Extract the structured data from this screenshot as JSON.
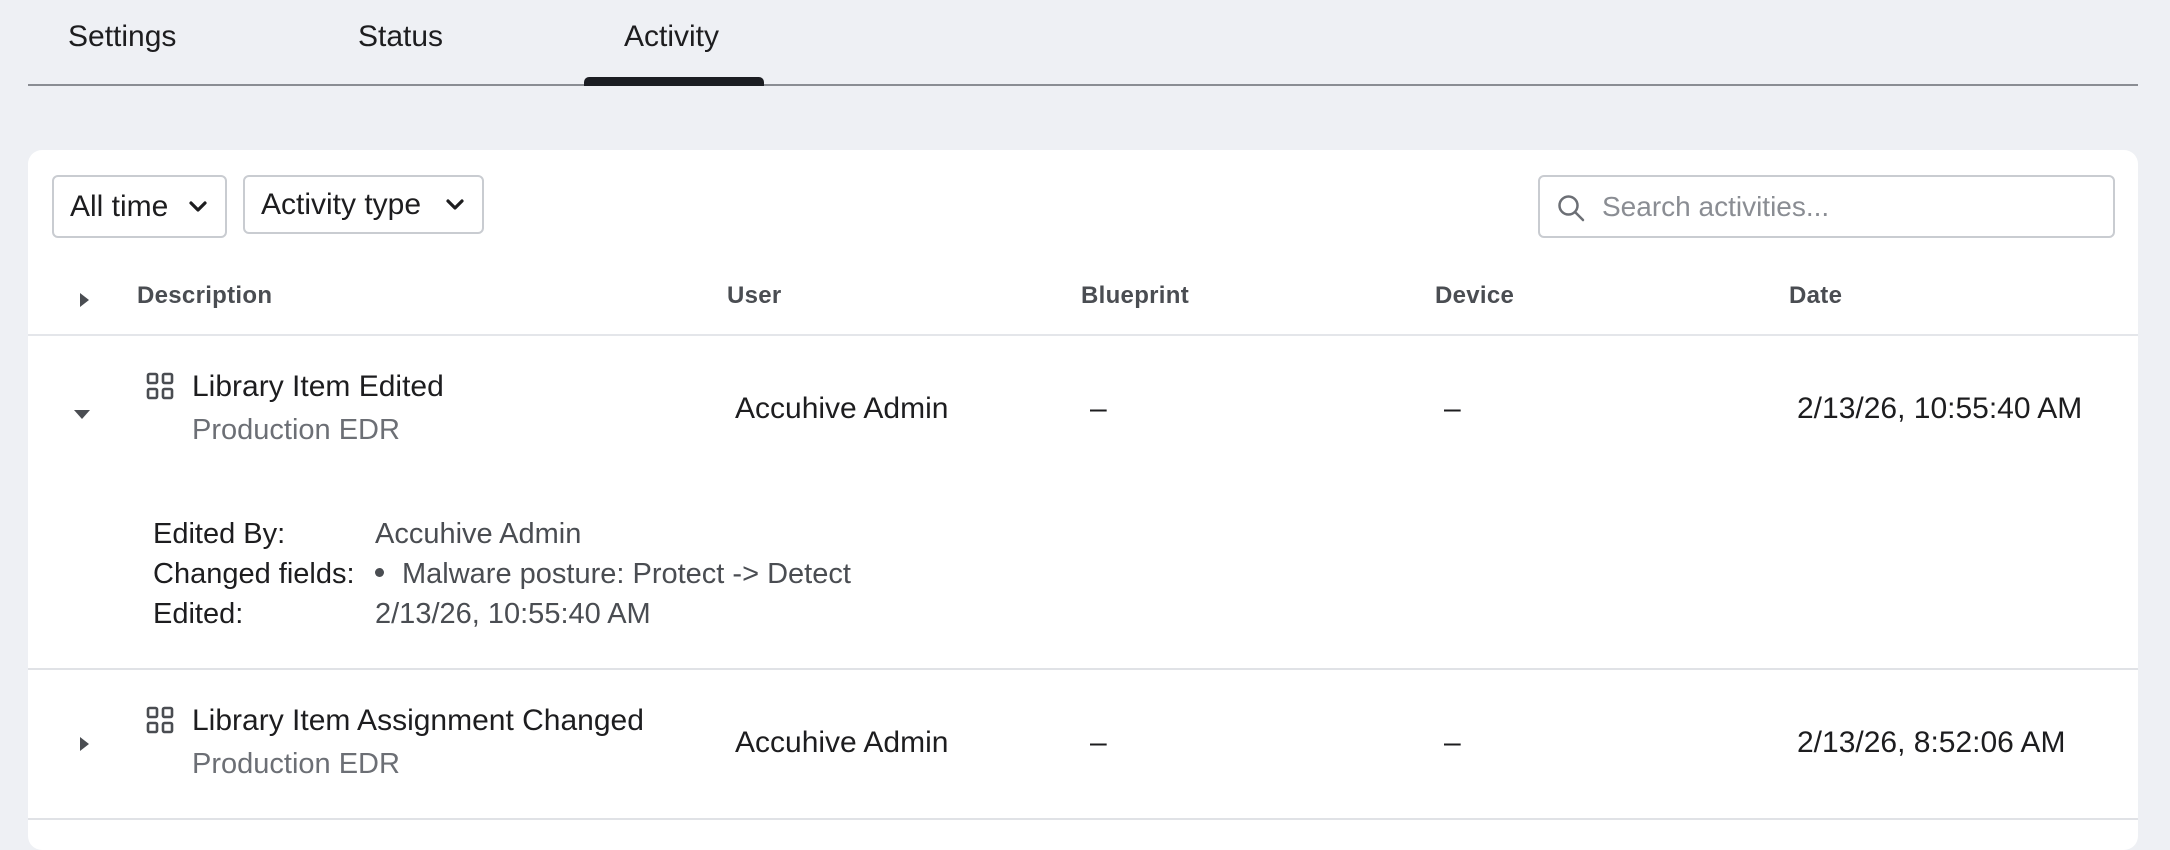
{
  "tabs": [
    {
      "label": "Settings",
      "active": false
    },
    {
      "label": "Status",
      "active": false
    },
    {
      "label": "Activity",
      "active": true
    }
  ],
  "filters": {
    "time": "All time",
    "activity_type": "Activity type"
  },
  "search": {
    "placeholder": "Search activities...",
    "value": ""
  },
  "table": {
    "columns": [
      "Description",
      "User",
      "Blueprint",
      "Device",
      "Date"
    ],
    "rows": [
      {
        "title": "Library Item Edited",
        "subtitle": "Production EDR",
        "user": "Accuhive Admin",
        "blueprint": "–",
        "device": "–",
        "date": "2/13/26, 10:55:40 AM",
        "expanded": true,
        "details": {
          "edited_by_label": "Edited By:",
          "edited_by_value": "Accuhive Admin",
          "changed_fields_label": "Changed fields:",
          "changed_fields": [
            "Malware posture: Protect -> Detect"
          ],
          "edited_label": "Edited:",
          "edited_value": "2/13/26, 10:55:40 AM"
        }
      },
      {
        "title": "Library Item Assignment Changed",
        "subtitle": "Production EDR",
        "user": "Accuhive Admin",
        "blueprint": "–",
        "device": "–",
        "date": "2/13/26, 8:52:06 AM",
        "expanded": false
      }
    ]
  },
  "colors": {
    "page_bg": "#eef0f4",
    "card_bg": "#ffffff",
    "tab_active_indicator": "#1b1d22",
    "muted_text": "#6c6f75"
  },
  "icons": {
    "expand_all": "caret-right-icon",
    "row_expanded": "caret-down-icon",
    "row_collapsed": "caret-right-icon",
    "library_item": "grid-icon",
    "dropdown": "chevron-down-icon",
    "search": "search-icon"
  }
}
